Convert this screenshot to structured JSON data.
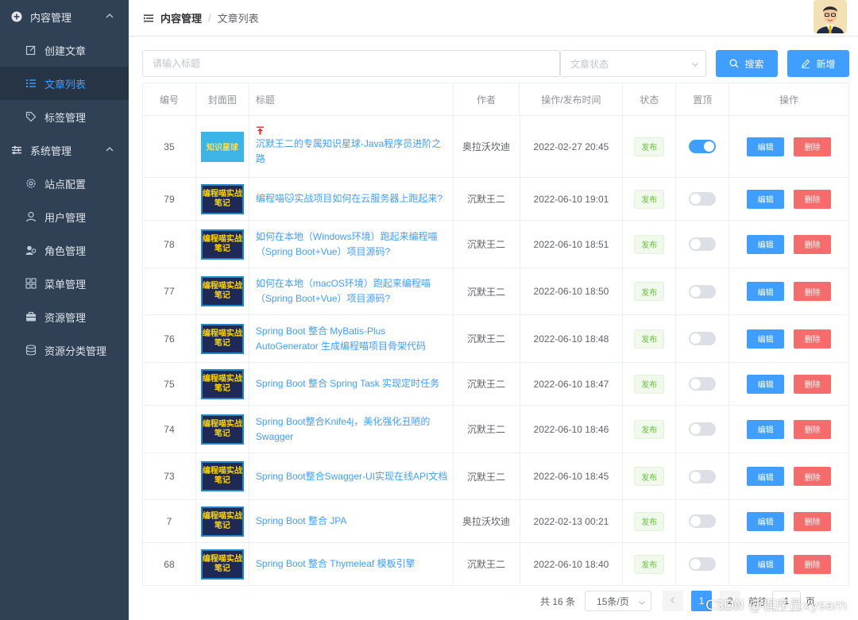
{
  "sidebar": {
    "groups": [
      {
        "label": "内容管理",
        "items": [
          "创建文章",
          "文章列表",
          "标签管理"
        ]
      },
      {
        "label": "系统管理",
        "items": [
          "站点配置",
          "用户管理",
          "角色管理",
          "菜单管理",
          "资源管理",
          "资源分类管理"
        ]
      }
    ]
  },
  "header": {
    "breadcrumb": [
      "内容管理",
      "文章列表"
    ],
    "separator": "/"
  },
  "toolbar": {
    "search_placeholder": "请输入标题",
    "status_placeholder": "文章状态",
    "search_label": "搜索",
    "add_label": "新增"
  },
  "table": {
    "columns": [
      "编号",
      "封面图",
      "标题",
      "作者",
      "操作/发布时间",
      "状态",
      "置顶",
      "操作"
    ],
    "rows": [
      {
        "id": "35",
        "cover": "知识星球",
        "title": "沉默王二的专属知识星球-Java程序员进阶之路",
        "author": "奥拉沃坎迪",
        "time": "2022-02-27 20:45",
        "status": "发布",
        "top": true
      },
      {
        "id": "79",
        "cover": "编程喵实战笔记",
        "title": "编程喵🐱实战项目如何在云服务器上跑起来?",
        "author": "沉默王二",
        "time": "2022-06-10 19:01",
        "status": "发布",
        "top": false
      },
      {
        "id": "78",
        "cover": "编程喵实战笔记",
        "title": "如何在本地（Windows环境）跑起来编程喵（Spring Boot+Vue）项目源码?",
        "author": "沉默王二",
        "time": "2022-06-10 18:51",
        "status": "发布",
        "top": false
      },
      {
        "id": "77",
        "cover": "编程喵实战笔记",
        "title": "如何在本地（macOS环境）跑起来编程喵（Spring Boot+Vue）项目源码?",
        "author": "沉默王二",
        "time": "2022-06-10 18:50",
        "status": "发布",
        "top": false
      },
      {
        "id": "76",
        "cover": "编程喵实战笔记",
        "title": "Spring Boot 整合 MyBatis-Plus AutoGenerator 生成编程喵项目骨架代码",
        "author": "沉默王二",
        "time": "2022-06-10 18:48",
        "status": "发布",
        "top": false
      },
      {
        "id": "75",
        "cover": "编程喵实战笔记",
        "title": "Spring Boot 整合 Spring Task 实现定时任务",
        "author": "沉默王二",
        "time": "2022-06-10 18:47",
        "status": "发布",
        "top": false
      },
      {
        "id": "74",
        "cover": "编程喵实战笔记",
        "title": "Spring Boot整合Knife4j，美化强化丑陋的Swagger",
        "author": "沉默王二",
        "time": "2022-06-10 18:46",
        "status": "发布",
        "top": false
      },
      {
        "id": "73",
        "cover": "编程喵实战笔记",
        "title": "Spring Boot整合Swagger-UI实现在线API文档",
        "author": "沉默王二",
        "time": "2022-06-10 18:45",
        "status": "发布",
        "top": false
      },
      {
        "id": "7",
        "cover": "编程喵实战笔记",
        "title": "Spring Boot 整合 JPA",
        "author": "奥拉沃坎迪",
        "time": "2022-02-13 00:21",
        "status": "发布",
        "top": false
      },
      {
        "id": "68",
        "cover": "编程喵实战笔记",
        "title": "Spring Boot 整合 Thymeleaf 模板引擎",
        "author": "沉默王二",
        "time": "2022-06-10 18:40",
        "status": "发布",
        "top": false
      }
    ],
    "edit_label": "编辑",
    "delete_label": "删除"
  },
  "pagination": {
    "total": "共 16 条",
    "page_size": "15条/页",
    "current_page": "1",
    "next_page": "2",
    "goto_label": "前往",
    "jump_value": "1",
    "page_suffix": "页"
  },
  "watermark": "CSDN @程序员xysam",
  "colors": {
    "primary": "#409eff",
    "danger": "#f56c6c",
    "sidebar_bg": "#304156",
    "success": "#67c23a"
  }
}
